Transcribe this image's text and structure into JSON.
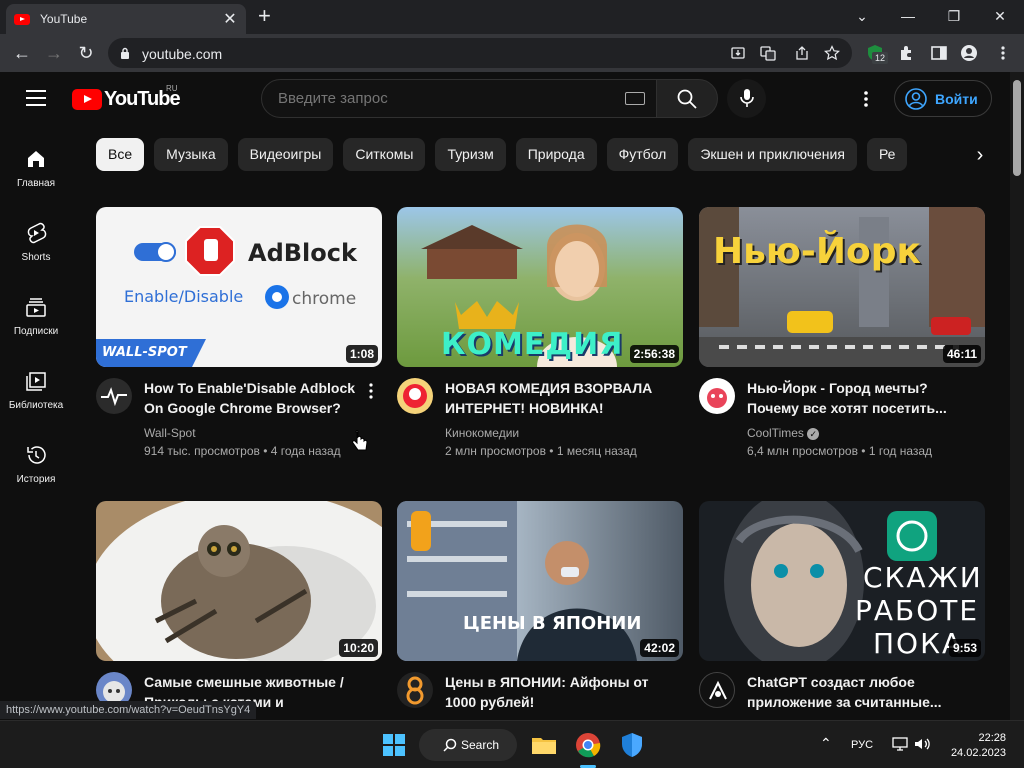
{
  "browser": {
    "tab_title": "YouTube",
    "url": "youtube.com",
    "extension_badge": "12"
  },
  "youtube": {
    "logo_text": "YouTube",
    "region": "RU",
    "search_placeholder": "Введите запрос",
    "signin_label": "Войти",
    "sidebar": [
      {
        "label": "Главная",
        "icon": "home-icon"
      },
      {
        "label": "Shorts",
        "icon": "shorts-icon"
      },
      {
        "label": "Подписки",
        "icon": "subscriptions-icon"
      },
      {
        "label": "Библиотека",
        "icon": "library-icon"
      },
      {
        "label": "История",
        "icon": "history-icon"
      }
    ],
    "chips": [
      "Все",
      "Музыка",
      "Видеоигры",
      "Ситкомы",
      "Туризм",
      "Природа",
      "Футбол",
      "Экшен и приключения",
      "Ре"
    ],
    "videos": [
      {
        "title": "How To Enable'Disable Adblock On Google Chrome Browser?",
        "channel": "Wall-Spot",
        "meta": "914 тыс. просмотров • 4 года назад",
        "duration": "1:08",
        "thumb_texts": [
          "AdBlock",
          "Enable/Disable",
          "chrome",
          "WALL-SPOT"
        ]
      },
      {
        "title": "НОВАЯ КОМЕДИЯ ВЗОРВАЛА ИНТЕРНЕТ! НОВИНКА! \"ПРИН...",
        "channel": "Кинокомедии",
        "meta": "2 млн просмотров • 1 месяц назад",
        "duration": "2:56:38",
        "thumb_texts": [
          "КОМЕДИЯ"
        ]
      },
      {
        "title": "Нью-Йорк - Город мечты? Почему все хотят посетить...",
        "channel": "CoolTimes",
        "meta": "6,4 млн просмотров • 1 год назад",
        "duration": "46:11",
        "thumb_texts": [
          "Нью-Йорк"
        ]
      },
      {
        "title": "Самые смешные животные / Приколы с котами и собаками...",
        "channel": "",
        "meta": "",
        "duration": "10:20",
        "thumb_texts": []
      },
      {
        "title": "Цены в ЯПОНИИ: Айфоны от 1000 рублей!",
        "channel": "",
        "meta": "",
        "duration": "42:02",
        "thumb_texts": [
          "ЦЕНЫ В ЯПОНИИ"
        ]
      },
      {
        "title": "ChatGPT создаст любое приложение за считанные...",
        "channel": "",
        "meta": "",
        "duration": "9:53",
        "thumb_texts": [
          "СКАЖИ",
          "РАБОТЕ",
          "ПОКА"
        ]
      }
    ]
  },
  "status_url": "https://www.youtube.com/watch?v=OeudTnsYgY4",
  "taskbar": {
    "search_label": "Search",
    "language": "РУС",
    "time": "22:28",
    "date": "24.02.2023"
  },
  "colors": {
    "youtube_red": "#ff0000",
    "link_blue": "#3ea6ff",
    "background": "#0f0f0f"
  }
}
